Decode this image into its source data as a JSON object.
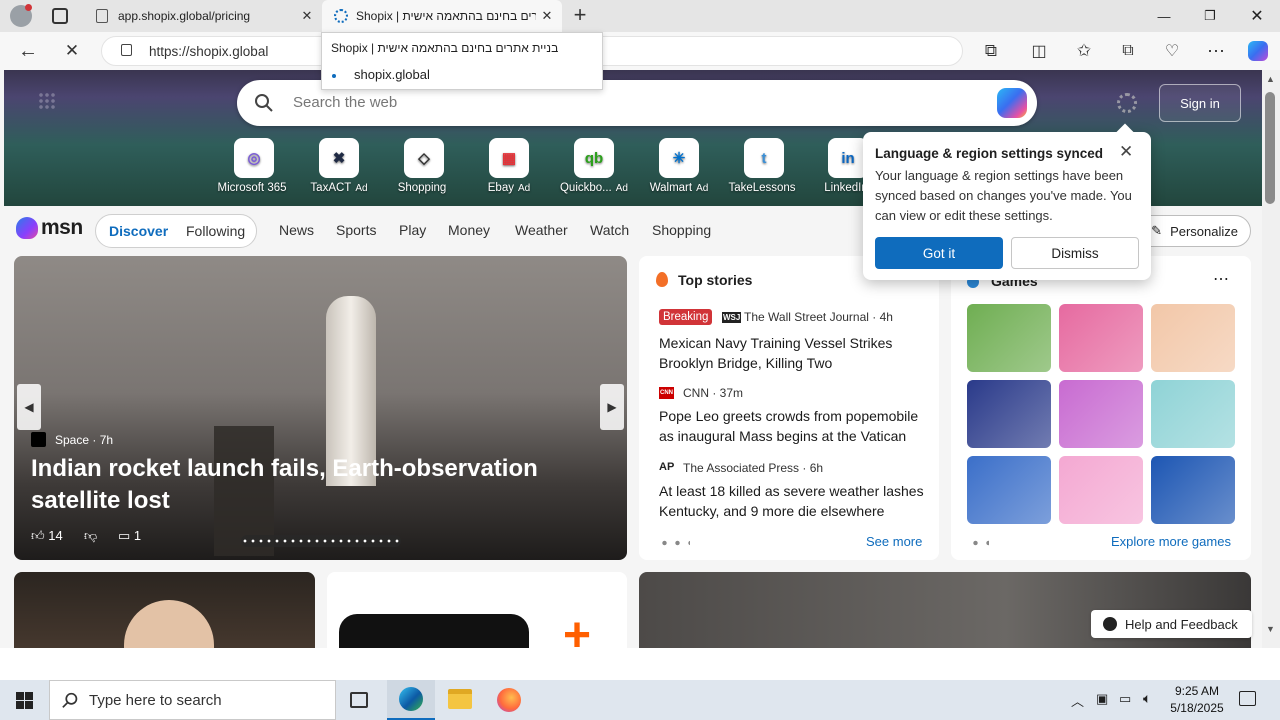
{
  "browser": {
    "tabs": [
      {
        "title": "app.shopix.global/pricing",
        "active": false
      },
      {
        "title": "Shopix | בניית אתרים בחינם בהתאמה אישית",
        "active": true
      }
    ],
    "url": "https://shopix.global",
    "tab_tooltip": {
      "title": "Shopix | בניית אתרים בחינם בהתאמה אישית",
      "domain": "shopix.global"
    }
  },
  "search": {
    "placeholder": "Search the web"
  },
  "header": {
    "sign_in": "Sign in"
  },
  "quick_links": [
    {
      "label": "Microsoft 365",
      "ad": "",
      "icon": "m365-icon",
      "color": "#7b5cd6",
      "glyph": "◎"
    },
    {
      "label": "TaxACT",
      "ad": "Ad",
      "icon": "taxact-icon",
      "color": "#1f2a44",
      "glyph": "✖"
    },
    {
      "label": "Shopping",
      "ad": "",
      "icon": "shopping-tag-icon",
      "color": "#333333",
      "glyph": "◇"
    },
    {
      "label": "Ebay",
      "ad": "Ad",
      "icon": "ebay-icon",
      "color": "#e53238",
      "glyph": "▦"
    },
    {
      "label": "Quickbo...",
      "ad": "Ad",
      "icon": "quickbooks-icon",
      "color": "#2ca01c",
      "glyph": "qb"
    },
    {
      "label": "Walmart",
      "ad": "Ad",
      "icon": "walmart-icon",
      "color": "#0071ce",
      "glyph": "✳"
    },
    {
      "label": "TakeLessons",
      "ad": "",
      "icon": "takelessons-icon",
      "color": "#3a8fd6",
      "glyph": "t"
    },
    {
      "label": "LinkedIn",
      "ad": "",
      "icon": "linkedin-icon",
      "color": "#0a66c2",
      "glyph": "in"
    }
  ],
  "msn": {
    "logo": "msn",
    "pivots": [
      "Discover",
      "Following"
    ],
    "nav": [
      "News",
      "Sports",
      "Play",
      "Money",
      "Weather",
      "Watch",
      "Shopping"
    ],
    "personalize": "Personalize"
  },
  "hero": {
    "source": "Space",
    "age": "7h",
    "title": "Indian rocket launch fails, Earth-observation satellite lost",
    "likes": "14",
    "comments": "1"
  },
  "top_stories": {
    "heading": "Top stories",
    "items": [
      {
        "badge": "Breaking",
        "source": "The Wall Street Journal",
        "age": "4h",
        "logo": "WSJ",
        "title": "Mexican Navy Training Vessel Strikes Brooklyn Bridge, Killing Two"
      },
      {
        "badge": "",
        "source": "CNN",
        "age": "37m",
        "logo": "CNN",
        "title": "Pope Leo greets crowds from popemobile as inaugural Mass begins at the Vatican"
      },
      {
        "badge": "",
        "source": "The Associated Press",
        "age": "6h",
        "logo": "AP",
        "title": "At least 18 killed as severe weather lashes Kentucky, and 9 more die elsewhere"
      }
    ],
    "see_more": "See more"
  },
  "games": {
    "heading": "Games",
    "explore": "Explore more games",
    "tiles": [
      "#6fae52",
      "#e66aa0",
      "#f2c7a8",
      "#2a3a8a",
      "#c86bd1",
      "#8fd3d6",
      "#3b6fc9",
      "#f4a8d2",
      "#1d56b3"
    ]
  },
  "popup": {
    "title": "Language & region settings synced",
    "body": "Your language & region settings have been synced based on changes you've made. You can view or edit these settings.",
    "primary": "Got it",
    "secondary": "Dismiss"
  },
  "feedback": {
    "label": "Help and Feedback"
  },
  "taskbar": {
    "search_placeholder": "Type here to search",
    "time": "9:25 AM",
    "date": "5/18/2025"
  },
  "colors": {
    "accent": "#0f6cbd",
    "breaking": "#d13438"
  }
}
